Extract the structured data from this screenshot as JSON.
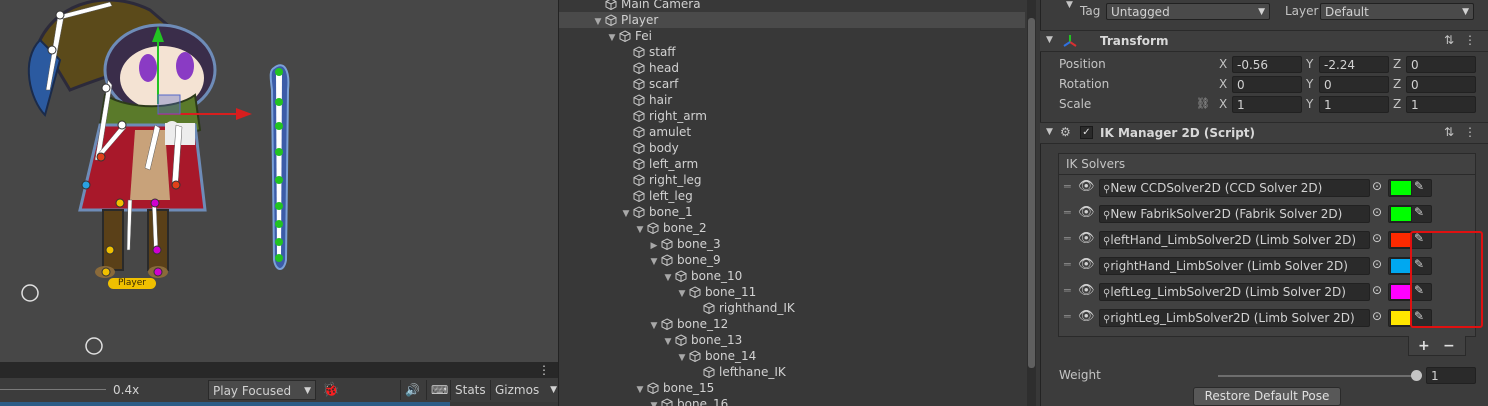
{
  "scene": {
    "player_label": "Player",
    "zoom": "0.4x",
    "play_mode": "Play Focused",
    "stats_label": "Stats",
    "gizmos_label": "Gizmos"
  },
  "hierarchy": {
    "items": [
      {
        "label": "Main Camera",
        "depth": 1,
        "arrow": ""
      },
      {
        "label": "Player",
        "depth": 1,
        "arrow": "down",
        "selected": true
      },
      {
        "label": "Fei",
        "depth": 2,
        "arrow": "down"
      },
      {
        "label": "staff",
        "depth": 3,
        "arrow": ""
      },
      {
        "label": "head",
        "depth": 3,
        "arrow": ""
      },
      {
        "label": "scarf",
        "depth": 3,
        "arrow": ""
      },
      {
        "label": "hair",
        "depth": 3,
        "arrow": ""
      },
      {
        "label": "right_arm",
        "depth": 3,
        "arrow": ""
      },
      {
        "label": "amulet",
        "depth": 3,
        "arrow": ""
      },
      {
        "label": "body",
        "depth": 3,
        "arrow": ""
      },
      {
        "label": "left_arm",
        "depth": 3,
        "arrow": ""
      },
      {
        "label": "right_leg",
        "depth": 3,
        "arrow": ""
      },
      {
        "label": "left_leg",
        "depth": 3,
        "arrow": ""
      },
      {
        "label": "bone_1",
        "depth": 3,
        "arrow": "down"
      },
      {
        "label": "bone_2",
        "depth": 4,
        "arrow": "down"
      },
      {
        "label": "bone_3",
        "depth": 5,
        "arrow": "right"
      },
      {
        "label": "bone_9",
        "depth": 5,
        "arrow": "down"
      },
      {
        "label": "bone_10",
        "depth": 6,
        "arrow": "down"
      },
      {
        "label": "bone_11",
        "depth": 7,
        "arrow": "down"
      },
      {
        "label": "righthand_IK",
        "depth": 8,
        "arrow": ""
      },
      {
        "label": "bone_12",
        "depth": 5,
        "arrow": "down"
      },
      {
        "label": "bone_13",
        "depth": 6,
        "arrow": "down"
      },
      {
        "label": "bone_14",
        "depth": 7,
        "arrow": "down"
      },
      {
        "label": "lefthane_IK",
        "depth": 8,
        "arrow": ""
      },
      {
        "label": "bone_15",
        "depth": 4,
        "arrow": "down"
      },
      {
        "label": "bone_16",
        "depth": 5,
        "arrow": "down"
      }
    ]
  },
  "inspector": {
    "tag_label": "Tag",
    "tag_value": "Untagged",
    "layer_label": "Layer",
    "layer_value": "Default",
    "transform": {
      "title": "Transform",
      "position_label": "Position",
      "rotation_label": "Rotation",
      "scale_label": "Scale",
      "axis_x": "X",
      "axis_y": "Y",
      "axis_z": "Z",
      "position": {
        "x": "-0.56",
        "y": "-2.24",
        "z": "0"
      },
      "rotation": {
        "x": "0",
        "y": "0",
        "z": "0"
      },
      "scale": {
        "x": "1",
        "y": "1",
        "z": "1"
      }
    },
    "ik": {
      "title": "IK Manager 2D (Script)",
      "solvers_label": "IK Solvers",
      "solvers": [
        {
          "name": "New CCDSolver2D (CCD Solver 2D)",
          "color": "#00ff00"
        },
        {
          "name": "New FabrikSolver2D (Fabrik Solver 2D)",
          "color": "#00ff00"
        },
        {
          "name": "leftHand_LimbSolver2D (Limb Solver 2D)",
          "color": "#ff2a00"
        },
        {
          "name": "rightHand_LimbSolver (Limb Solver 2D)",
          "color": "#00a8f0"
        },
        {
          "name": "leftLeg_LimbSolver2D (Limb Solver 2D)",
          "color": "#ff00ff"
        },
        {
          "name": "rightLeg_LimbSolver2D (Limb Solver 2D)",
          "color": "#ffe600"
        }
      ],
      "add_label": "+",
      "remove_label": "−",
      "weight_label": "Weight",
      "weight_value": "1",
      "weight_fraction": 1.0,
      "restore_label": "Restore Default Pose"
    },
    "highlight_color": "#e01010"
  }
}
